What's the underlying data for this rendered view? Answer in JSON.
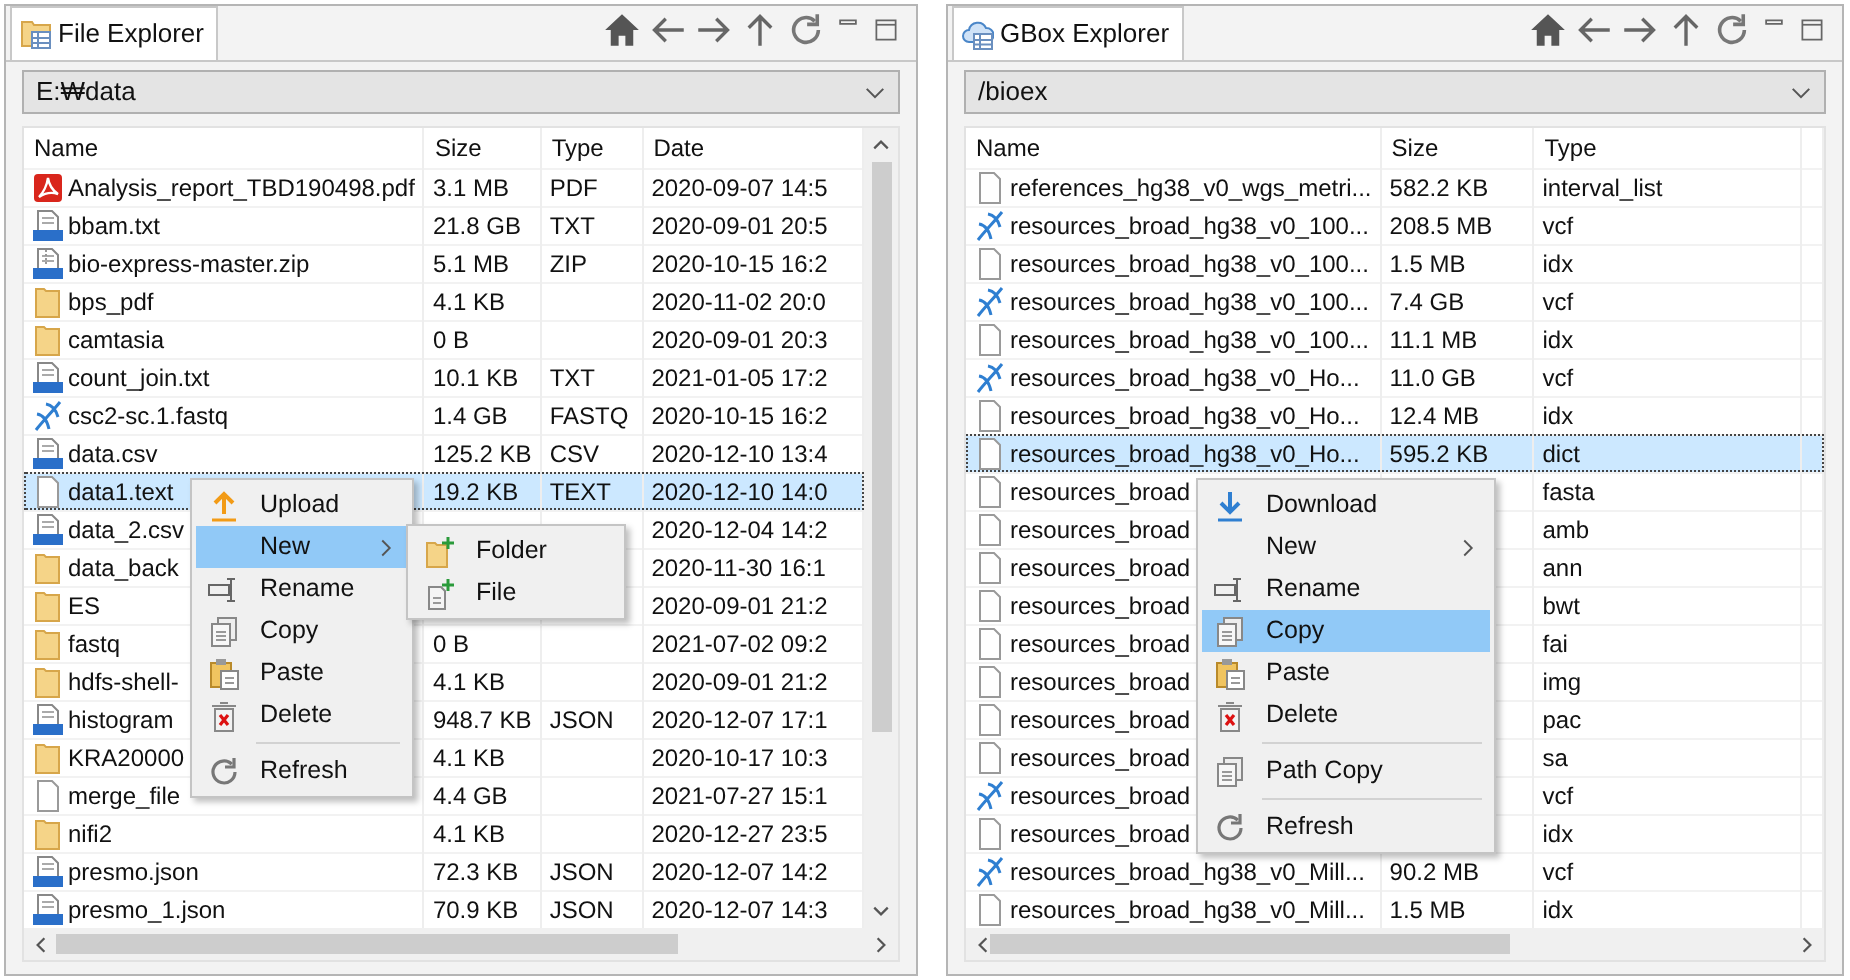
{
  "panels": [
    {
      "title": "File Explorer",
      "kind": "local",
      "path": "E:₩data",
      "columns": [
        "Name",
        "Size",
        "Type",
        "Date"
      ],
      "rows": [
        {
          "kind": "pdf",
          "name": "Analysis_report_TBD190498.pdf",
          "size": "3.1 MB",
          "type": "PDF",
          "date": "2020-09-07 14:5",
          "selected": false
        },
        {
          "kind": "txt",
          "name": "bbam.txt",
          "size": "21.8 GB",
          "type": "TXT",
          "date": "2020-09-01 20:5",
          "selected": false
        },
        {
          "kind": "zip",
          "name": "bio-express-master.zip",
          "size": "5.1 MB",
          "type": "ZIP",
          "date": "2020-10-15 16:2",
          "selected": false
        },
        {
          "kind": "folder",
          "name": "bps_pdf",
          "size": "4.1 KB",
          "date": "2020-11-02 20:0",
          "selected": false
        },
        {
          "kind": "folder",
          "name": "camtasia",
          "size": "0 B",
          "date": "2020-09-01 20:3",
          "selected": false
        },
        {
          "kind": "txt",
          "name": "count_join.txt",
          "size": "10.1 KB",
          "type": "TXT",
          "date": "2021-01-05 17:2",
          "selected": false
        },
        {
          "kind": "dna",
          "name": "csc2-sc.1.fastq",
          "size": "1.4 GB",
          "type": "FASTQ",
          "date": "2020-10-15 16:2",
          "selected": false
        },
        {
          "kind": "csv",
          "name": "data.csv",
          "size": "125.2 KB",
          "type": "CSV",
          "date": "2020-12-10 13:4",
          "selected": false
        },
        {
          "kind": "file",
          "name": "data1.text",
          "size": "19.2 KB",
          "type": "TEXT",
          "date": "2020-12-10 14:0",
          "selected": true
        },
        {
          "kind": "csv",
          "name": "data_2.csv",
          "date": "2020-12-04 14:2",
          "selected": false
        },
        {
          "kind": "folder",
          "name": "data_back",
          "date": "2020-11-30 16:1",
          "selected": false
        },
        {
          "kind": "folder",
          "name": "ES",
          "date": "2020-09-01 21:2",
          "selected": false
        },
        {
          "kind": "folder",
          "name": "fastq",
          "size": "0 B",
          "date": "2021-07-02 09:2",
          "selected": false
        },
        {
          "kind": "folder",
          "name": "hdfs-shell-",
          "size": "4.1 KB",
          "date": "2020-09-01 21:2",
          "selected": false
        },
        {
          "kind": "json",
          "name": "histogram",
          "size": "948.7 KB",
          "type": "JSON",
          "date": "2020-12-07 17:1",
          "selected": false
        },
        {
          "kind": "folder",
          "name": "KRA20000",
          "size": "4.1 KB",
          "date": "2020-10-17 10:3",
          "selected": false
        },
        {
          "kind": "file",
          "name": "merge_file",
          "size": "4.4 GB",
          "date": "2021-07-27 15:1",
          "selected": false
        },
        {
          "kind": "folder",
          "name": "nifi2",
          "size": "4.1 KB",
          "date": "2020-12-27 23:5",
          "selected": false
        },
        {
          "kind": "json",
          "name": "presmo.json",
          "size": "72.3 KB",
          "type": "JSON",
          "date": "2020-12-07 14:2",
          "selected": false
        },
        {
          "kind": "json",
          "name": "presmo_1.json",
          "size": "70.9 KB",
          "type": "JSON",
          "date": "2020-12-07 14:3",
          "selected": false
        }
      ],
      "context_menu": [
        {
          "kind": "upload",
          "label": "Upload",
          "highlighted": false,
          "has_submenu": false,
          "divider_before": false
        },
        {
          "kind": "plain",
          "label": "New",
          "highlighted": true,
          "has_submenu": true,
          "divider_before": false
        },
        {
          "kind": "rename",
          "label": "Rename",
          "highlighted": false,
          "has_submenu": false,
          "divider_before": false
        },
        {
          "kind": "copy",
          "label": "Copy",
          "highlighted": false,
          "has_submenu": false,
          "divider_before": false
        },
        {
          "kind": "paste",
          "label": "Paste",
          "highlighted": false,
          "has_submenu": false,
          "divider_before": false
        },
        {
          "kind": "delete",
          "label": "Delete",
          "highlighted": false,
          "has_submenu": false,
          "divider_before": false
        },
        {
          "kind": "refresh",
          "label": "Refresh",
          "highlighted": false,
          "has_submenu": false,
          "divider_before": true
        }
      ],
      "submenu": [
        {
          "kind": "new-folder",
          "label": "Folder",
          "highlighted": false,
          "has_submenu": false,
          "divider_before": false
        },
        {
          "kind": "new-file",
          "label": "File",
          "highlighted": false,
          "has_submenu": false,
          "divider_before": false
        }
      ]
    },
    {
      "title": "GBox Explorer",
      "kind": "cloud",
      "path": "/bioex",
      "columns": [
        "Name",
        "Size",
        "Type"
      ],
      "rows": [
        {
          "kind": "file",
          "name": "references_hg38_v0_wgs_metri...",
          "size": "582.2 KB",
          "type": "interval_list",
          "selected": false
        },
        {
          "kind": "dna",
          "name": "resources_broad_hg38_v0_100...",
          "size": "208.5 MB",
          "type": "vcf",
          "selected": false
        },
        {
          "kind": "file",
          "name": "resources_broad_hg38_v0_100...",
          "size": "1.5 MB",
          "type": "idx",
          "selected": false
        },
        {
          "kind": "dna",
          "name": "resources_broad_hg38_v0_100...",
          "size": "7.4 GB",
          "type": "vcf",
          "selected": false
        },
        {
          "kind": "file",
          "name": "resources_broad_hg38_v0_100...",
          "size": "11.1 MB",
          "type": "idx",
          "selected": false
        },
        {
          "kind": "dna",
          "name": "resources_broad_hg38_v0_Ho...",
          "size": "11.0 GB",
          "type": "vcf",
          "selected": false
        },
        {
          "kind": "file",
          "name": "resources_broad_hg38_v0_Ho...",
          "size": "12.4 MB",
          "type": "idx",
          "selected": false
        },
        {
          "kind": "file",
          "name": "resources_broad_hg38_v0_Ho...",
          "size": "595.2 KB",
          "type": "dict",
          "selected": true
        },
        {
          "kind": "file",
          "name": "resources_broad",
          "type": "fasta",
          "selected": false
        },
        {
          "kind": "file",
          "name": "resources_broad",
          "type": "amb",
          "selected": false
        },
        {
          "kind": "file",
          "name": "resources_broad",
          "type": "ann",
          "selected": false
        },
        {
          "kind": "file",
          "name": "resources_broad",
          "type": "bwt",
          "selected": false
        },
        {
          "kind": "file",
          "name": "resources_broad",
          "type": "fai",
          "selected": false
        },
        {
          "kind": "file",
          "name": "resources_broad",
          "type": "img",
          "selected": false
        },
        {
          "kind": "file",
          "name": "resources_broad",
          "type": "pac",
          "selected": false
        },
        {
          "kind": "file",
          "name": "resources_broad",
          "type": "sa",
          "selected": false
        },
        {
          "kind": "dna",
          "name": "resources_broad",
          "type": "vcf",
          "selected": false
        },
        {
          "kind": "file",
          "name": "resources_broad",
          "type": "idx",
          "selected": false
        },
        {
          "kind": "dna",
          "name": "resources_broad_hg38_v0_Mill...",
          "size": "90.2 MB",
          "type": "vcf",
          "selected": false
        },
        {
          "kind": "file",
          "name": "resources_broad_hg38_v0_Mill...",
          "size": "1.5 MB",
          "type": "idx",
          "selected": false
        }
      ],
      "context_menu": [
        {
          "kind": "download",
          "label": "Download",
          "highlighted": false,
          "has_submenu": false,
          "divider_before": false
        },
        {
          "kind": "plain",
          "label": "New",
          "highlighted": false,
          "has_submenu": true,
          "divider_before": false
        },
        {
          "kind": "rename",
          "label": "Rename",
          "highlighted": false,
          "has_submenu": false,
          "divider_before": false
        },
        {
          "kind": "copy",
          "label": "Copy",
          "highlighted": true,
          "has_submenu": false,
          "divider_before": false
        },
        {
          "kind": "paste",
          "label": "Paste",
          "highlighted": false,
          "has_submenu": false,
          "divider_before": false
        },
        {
          "kind": "delete",
          "label": "Delete",
          "highlighted": false,
          "has_submenu": false,
          "divider_before": false
        },
        {
          "kind": "copy",
          "label": "Path Copy",
          "highlighted": false,
          "has_submenu": false,
          "divider_before": true
        },
        {
          "kind": "refresh",
          "label": "Refresh",
          "highlighted": false,
          "has_submenu": false,
          "divider_before": true
        }
      ]
    }
  ]
}
